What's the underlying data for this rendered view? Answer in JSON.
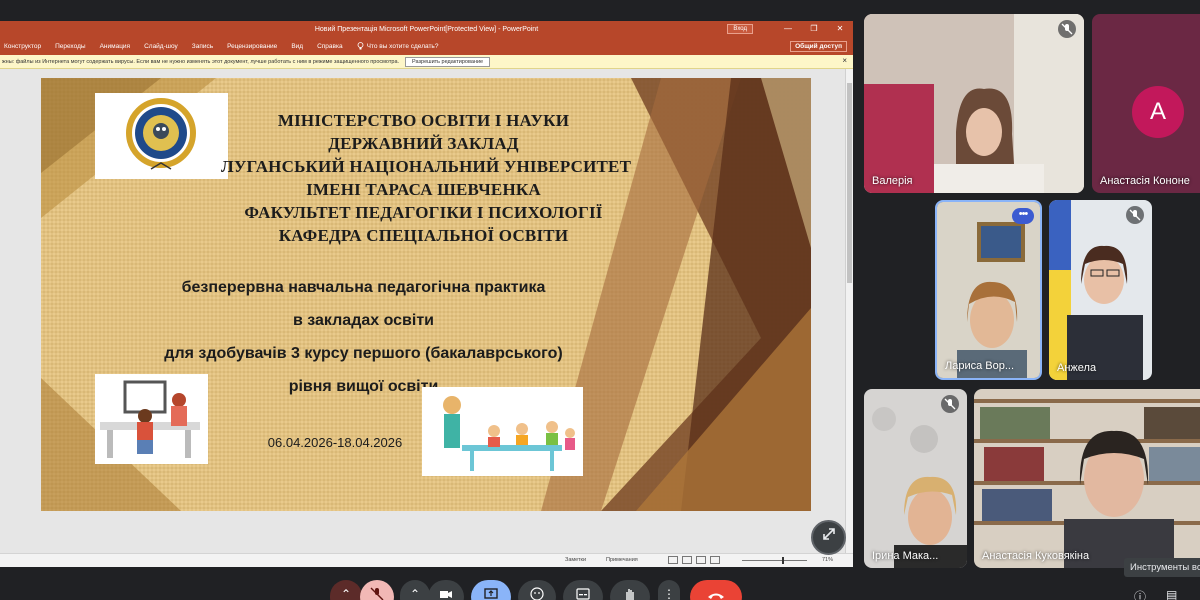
{
  "powerpoint": {
    "title": "Новий Презентація Microsoft PowerPoint[Protected View] - PowerPoint",
    "login_label": "Вход",
    "window_controls": [
      "—",
      "❐",
      "✕"
    ],
    "menu": [
      "Конструктор",
      "Переходы",
      "Анимация",
      "Слайд-шоу",
      "Запись",
      "Рецензирование",
      "Вид",
      "Справка"
    ],
    "tell_me": "Что вы хотите сделать?",
    "share_label": "Общий доступ",
    "protected_msg": "жны: файлы из Интернета могут содержать вирусы. Если вам не нужно изменять этот документ, лучше работать с ним в режиме защищенного просмотра.",
    "enable_editing": "Разрешить редактирование",
    "status": {
      "notes": "Заметки",
      "comments": "Примечания",
      "zoom": "71%"
    }
  },
  "slide": {
    "heading_lines": [
      "МІНІСТЕРСТВО ОСВІТИ І НАУКИ",
      "ДЕРЖАВНИЙ ЗАКЛАД",
      "ЛУГАНСЬКИЙ НАЦІОНАЛЬНИЙ УНІВЕРСИТЕТ",
      "ІМЕНІ ТАРАСА ШЕВЧЕНКА",
      "ФАКУЛЬТЕТ ПЕДАГОГІКИ І ПСИХОЛОГІЇ",
      "КАФЕДРА СПЕЦІАЛЬНОЇ ОСВІТИ"
    ],
    "subtitle_lines": [
      "безперервна навчальна педагогічна практика",
      "в закладах освіти",
      "для здобувачів 3 курсу першого (бакалаврського)",
      "рівня вищої освіти"
    ],
    "dates": "06.04.2026-18.04.2026"
  },
  "participants": [
    {
      "name": "Валерія",
      "muted": true
    },
    {
      "name": "Анастасія Кононе",
      "initial": "А",
      "avatar_color": "#c2185b"
    },
    {
      "name": "Лариса Вор...",
      "speaking": true
    },
    {
      "name": "Анжела",
      "muted": true
    },
    {
      "name": "Ірина Мака...",
      "muted": true
    },
    {
      "name": "Анастасія Куковякіна"
    }
  ],
  "tooltip": "Инструменты вст",
  "icons": {
    "expand": "expand-icon",
    "mic_off": "mic-off-icon",
    "more": "more-options-icon"
  }
}
